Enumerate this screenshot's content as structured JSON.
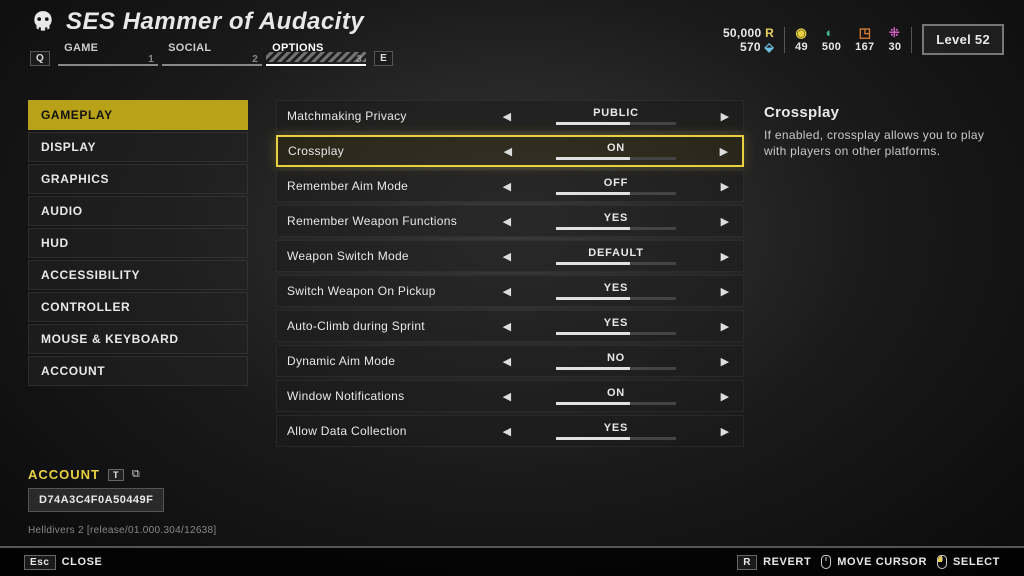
{
  "header": {
    "ship_title": "SES Hammer of Audacity",
    "left_key": "Q",
    "right_key": "E",
    "tabs": [
      {
        "label": "GAME",
        "num": "1"
      },
      {
        "label": "SOCIAL",
        "num": "2"
      },
      {
        "label": "OPTIONS",
        "num": "3"
      }
    ],
    "active_tab_index": 2
  },
  "resources": {
    "req": "50,000",
    "credits": "570",
    "items": [
      {
        "name": "medals",
        "value": "49",
        "color": "#e8d040",
        "glyph": "◉"
      },
      {
        "name": "common",
        "value": "500",
        "color": "#3fbf8f",
        "glyph": "◐"
      },
      {
        "name": "rare",
        "value": "167",
        "color": "#e08030",
        "glyph": "◳"
      },
      {
        "name": "super",
        "value": "30",
        "color": "#d060c0",
        "glyph": "⁜"
      }
    ],
    "level_label": "Level 52"
  },
  "categories": [
    "GAMEPLAY",
    "DISPLAY",
    "GRAPHICS",
    "AUDIO",
    "HUD",
    "ACCESSIBILITY",
    "CONTROLLER",
    "MOUSE & KEYBOARD",
    "ACCOUNT"
  ],
  "active_category_index": 0,
  "settings": [
    {
      "label": "Matchmaking Privacy",
      "value": "PUBLIC"
    },
    {
      "label": "Crossplay",
      "value": "ON"
    },
    {
      "label": "Remember Aim Mode",
      "value": "OFF"
    },
    {
      "label": "Remember Weapon Functions",
      "value": "YES"
    },
    {
      "label": "Weapon Switch Mode",
      "value": "DEFAULT"
    },
    {
      "label": "Switch Weapon On Pickup",
      "value": "YES"
    },
    {
      "label": "Auto-Climb during Sprint",
      "value": "YES"
    },
    {
      "label": "Dynamic Aim Mode",
      "value": "NO"
    },
    {
      "label": "Window Notifications",
      "value": "ON"
    },
    {
      "label": "Allow Data Collection",
      "value": "YES"
    }
  ],
  "selected_setting_index": 1,
  "description": {
    "title": "Crossplay",
    "text": "If enabled, crossplay allows you to play with players on other platforms."
  },
  "account": {
    "label": "ACCOUNT",
    "key_hint": "T",
    "id": "D74A3C4F0A50449F"
  },
  "build_info": "Helldivers 2 [release/01.000.304/12638]",
  "footer": {
    "close_key": "Esc",
    "close_label": "CLOSE",
    "revert_key": "R",
    "revert_label": "REVERT",
    "move_label": "MOVE CURSOR",
    "select_label": "SELECT"
  }
}
